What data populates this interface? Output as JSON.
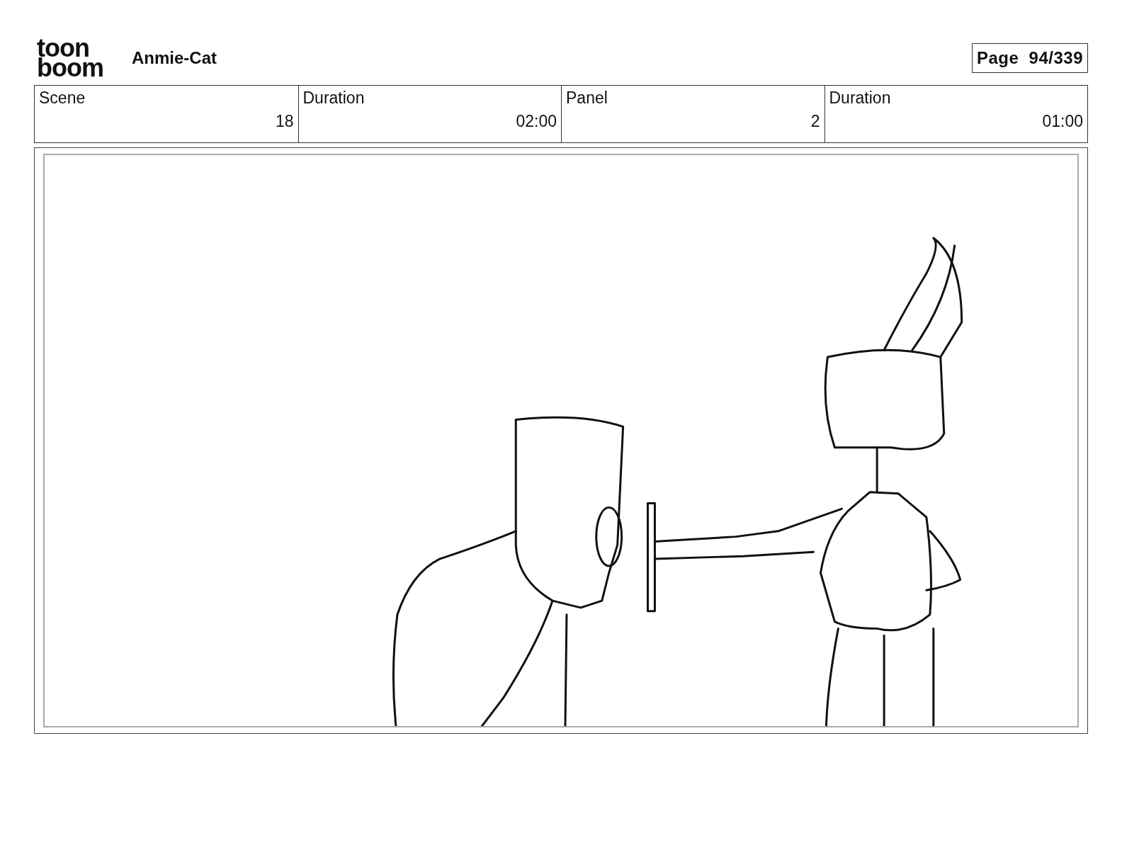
{
  "header": {
    "logo": [
      "toon",
      "boom"
    ],
    "title": "Anmie-Cat",
    "page": "Page  94/339"
  },
  "info_table": {
    "columns": [
      "Scene",
      "Duration",
      "Panel",
      "Duration"
    ],
    "values": [
      "18",
      "02:00",
      "2",
      "01:00"
    ]
  }
}
